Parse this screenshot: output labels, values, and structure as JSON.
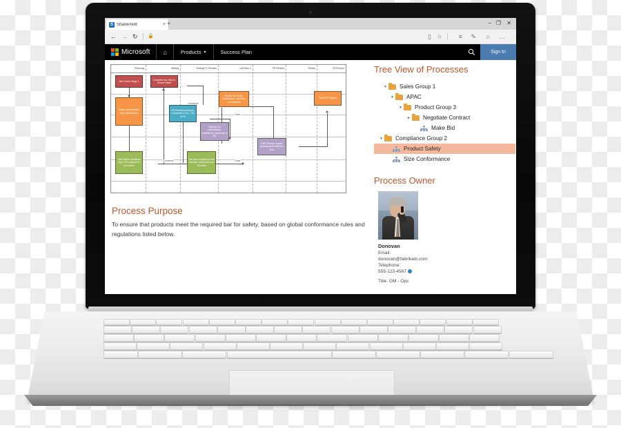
{
  "browser": {
    "tab": {
      "title": "SharePoint",
      "favicon_icon": "sharepoint-icon",
      "close_icon": "×"
    },
    "new_tab_icon": "+",
    "window_controls": {
      "minimize": "−",
      "maximize": "❐",
      "close": "✕"
    },
    "nav": {
      "back_icon": "←",
      "forward_icon": "→",
      "refresh_icon": "↻",
      "lock_icon": "🔒",
      "address_value": ""
    },
    "toolbar_icons": [
      {
        "name": "reading-view-icon",
        "glyph": "▯"
      },
      {
        "name": "favorites-star-icon",
        "glyph": "☆"
      },
      {
        "name": "hub-icon",
        "glyph": "≡"
      },
      {
        "name": "web-notes-icon",
        "glyph": "✎"
      },
      {
        "name": "share-icon",
        "glyph": "⌂"
      },
      {
        "name": "settings-more-icon",
        "glyph": "…"
      }
    ]
  },
  "suite_bar": {
    "brand": "Microsoft",
    "home_icon": "⌂",
    "products_label": "Products",
    "products_caret": "▾",
    "site_label": "Success Plan",
    "search_icon": "search-icon",
    "signin_label": "Sign In",
    "signin_color": "#4a7cb0",
    "logo_colors": [
      "#f25022",
      "#7fba00",
      "#00a4ef",
      "#ffb900"
    ]
  },
  "diagram": {
    "columns": [
      "Planning",
      "Writing",
      "Testing/TC Review",
      "UA Pass 1",
      "TR Review",
      "Phase",
      "TR Review"
    ],
    "nodes": [
      {
        "id": "n1",
        "label": "Dev Driven Stage 1",
        "color": "red"
      },
      {
        "id": "n2",
        "label": "Complete doc, files to Source Depot",
        "color": "red"
      },
      {
        "id": "n3",
        "label": "Scope determination Spec identification",
        "color": "orange"
      },
      {
        "id": "n4",
        "label": "PM Reviews protocols, Comments in doc, TDs in PS",
        "color": "blue"
      },
      {
        "id": "n5",
        "label": "Review for clarity, conciseness, accuracy, conformance",
        "color": "orange"
      },
      {
        "id": "n6",
        "label": "Final PDF Signoff",
        "color": "orange"
      },
      {
        "id": "n7",
        "label": "Edit files for conformance, consistency, comments to file",
        "color": "purple"
      },
      {
        "id": "n8",
        "label": "Edit Criteria: Workflow bug in PS assigned to doc author",
        "color": "green"
      },
      {
        "id": "n9",
        "label": "Test plan complete for file formats, commands and TDs filed",
        "color": "green"
      },
      {
        "id": "n10",
        "label": "Edit Cleanup, regular glossary and reference links",
        "color": "purple"
      }
    ],
    "edge_labels": [
      "Comments",
      "Clean",
      "Comments",
      "Clean",
      "Comments",
      "Clean"
    ],
    "colors": {
      "red": "#c0504d",
      "orange": "#f79646",
      "blue": "#4bacc6",
      "green": "#9bbb59",
      "purple": "#b3a2c7"
    }
  },
  "purpose": {
    "heading": "Process Purpose",
    "text": "To ensure that products meet the required bar for safety, based on global conformance rules and regulations listed below."
  },
  "tree": {
    "heading": "Tree View of Processes",
    "selection_color": "#f6b89c",
    "items": [
      {
        "label": "Sales Group 1",
        "indent": 0,
        "icon": "folder-icon",
        "twisty": "expanded",
        "selected": false
      },
      {
        "label": "APAC",
        "indent": 1,
        "icon": "folder-icon",
        "twisty": "expanded",
        "selected": false
      },
      {
        "label": "Product Group 3",
        "indent": 2,
        "icon": "folder-icon",
        "twisty": "expanded",
        "selected": false
      },
      {
        "label": "Negotiate Contract",
        "indent": 3,
        "icon": "folder-icon",
        "twisty": "collapsed",
        "selected": false
      },
      {
        "label": "Make Bid",
        "indent": 4,
        "icon": "org-chart-icon",
        "twisty": "none",
        "selected": false
      },
      {
        "label": "Compliance Group 2",
        "indent": 0,
        "icon": "folder-icon",
        "twisty": "expanded",
        "selected": false
      },
      {
        "label": "Product Safety",
        "indent": 1,
        "icon": "org-chart-icon",
        "twisty": "none",
        "selected": true
      },
      {
        "label": "Size Conformance",
        "indent": 1,
        "icon": "org-chart-icon",
        "twisty": "none",
        "selected": false
      }
    ]
  },
  "owner": {
    "heading": "Process Owner",
    "photo_alt": "man-on-phone-photo",
    "name": "Donovan",
    "email_label": "Email:",
    "email": "donovan@fabrikam.com",
    "telephone_label": "Telephone:",
    "telephone": "555-123-4567",
    "presence_icon": "presence-available-icon",
    "title": "Title: GM - Ops"
  },
  "heading_color": "#c0562a"
}
